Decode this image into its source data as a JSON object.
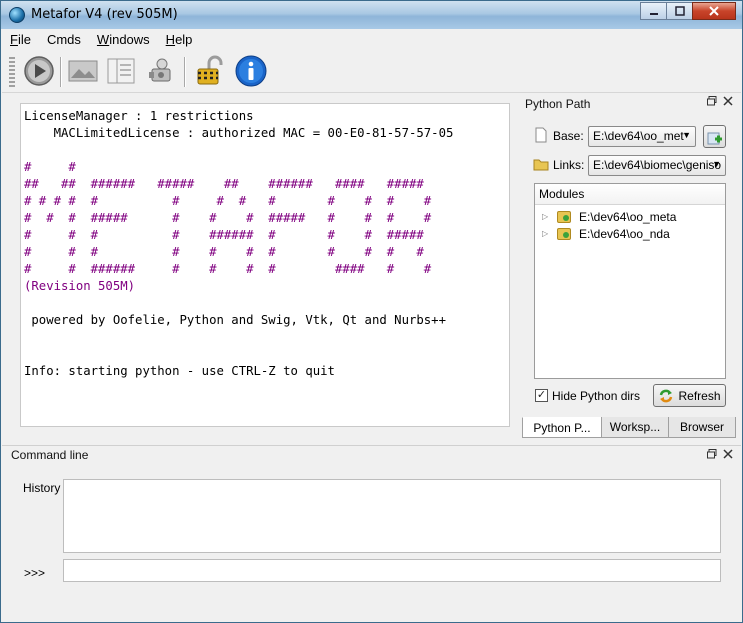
{
  "window": {
    "title": "Metafor V4 (rev 505M)",
    "controls": [
      "minimize",
      "maximize",
      "close"
    ]
  },
  "menu": [
    {
      "label": "File",
      "accel": "F",
      "rest": "ile"
    },
    {
      "label": "Cmds",
      "accel": "",
      "rest": "Cmds"
    },
    {
      "label": "Windows",
      "accel": "W",
      "rest": "indows"
    },
    {
      "label": "Help",
      "accel": "H",
      "rest": "elp"
    }
  ],
  "toolbar": {
    "icons": [
      "play-icon",
      "image-icon",
      "layout-icon",
      "camera-icon",
      "padlock-icon",
      "info-icon"
    ]
  },
  "console": {
    "lines": [
      {
        "text": "LicenseManager : 1 restrictions",
        "color": "#000000"
      },
      {
        "text": "    MACLimitedLicense : authorized MAC = 00-E0-81-57-57-05",
        "color": "#000000"
      },
      {
        "text": "",
        "color": "#000000"
      },
      {
        "text": "#     #",
        "color": "#800080"
      },
      {
        "text": "##   ##  ######   #####    ##    ######   ####   #####",
        "color": "#800080"
      },
      {
        "text": "# # # #  #          #     #  #   #       #    #  #    #",
        "color": "#800080"
      },
      {
        "text": "#  #  #  #####      #    #    #  #####   #    #  #    #",
        "color": "#800080"
      },
      {
        "text": "#     #  #          #    ######  #       #    #  #####",
        "color": "#800080"
      },
      {
        "text": "#     #  #          #    #    #  #       #    #  #   #",
        "color": "#800080"
      },
      {
        "text": "#     #  ######     #    #    #  #        ####   #    #",
        "color": "#800080"
      },
      {
        "text": "(Revision 505M)",
        "color": "#800080"
      },
      {
        "text": "",
        "color": "#000000"
      },
      {
        "text": " powered by Oofelie, Python and Swig, Vtk, Qt and Nurbs++",
        "color": "#000000"
      },
      {
        "text": "",
        "color": "#000000"
      },
      {
        "text": "",
        "color": "#000000"
      },
      {
        "text": "Info: starting python - use CTRL-Z to quit",
        "color": "#000000"
      }
    ]
  },
  "python_path": {
    "title": "Python Path",
    "base_label": "Base:",
    "base_value": "E:\\dev64\\oo_met",
    "links_label": "Links:",
    "links_value": "E:\\dev64\\biomec\\geniso",
    "modules_header": "Modules",
    "modules": [
      "E:\\dev64\\oo_meta",
      "E:\\dev64\\oo_nda"
    ],
    "hide_label": "Hide Python dirs",
    "hide_checked": true,
    "refresh_label": "Refresh"
  },
  "tabs": [
    "Python P...",
    "Worksp...",
    "Browser"
  ],
  "command_line": {
    "title": "Command line",
    "history_label": "History",
    "prompt": ">>>"
  }
}
